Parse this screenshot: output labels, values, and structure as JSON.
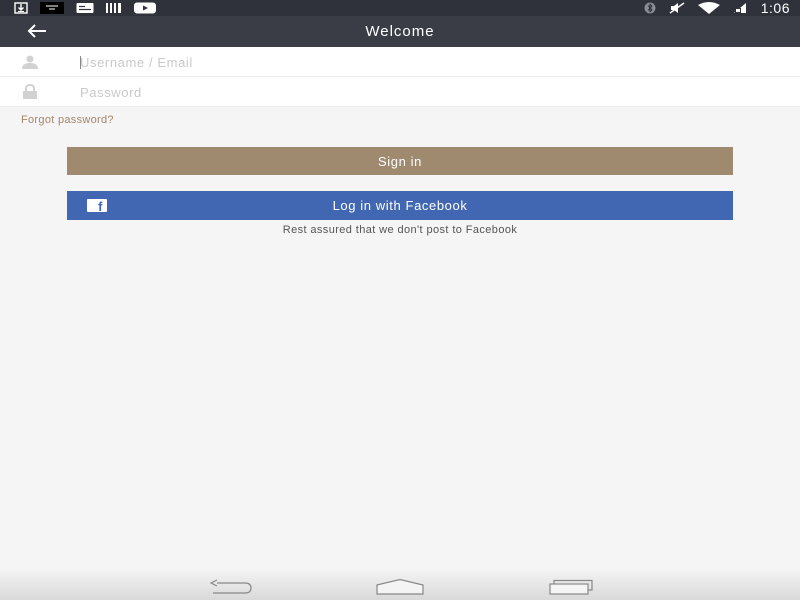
{
  "status_bar": {
    "time": "1:06",
    "left_icons": [
      "download-icon",
      "keyboard-icon",
      "message-icon",
      "barcode-icon",
      "youtube-icon"
    ],
    "right_icons": [
      "bluetooth-icon",
      "mute-icon",
      "wifi-icon",
      "signal-icon"
    ]
  },
  "app_bar": {
    "title": "Welcome"
  },
  "login": {
    "username_placeholder": "Username / Email",
    "password_placeholder": "Password",
    "forgot_password": "Forgot password?",
    "sign_in_label": "Sign in",
    "facebook_label": "Log in with Facebook",
    "facebook_note": "Rest assured that we don't post to Facebook"
  },
  "colors": {
    "status_bar": "#2f323a",
    "app_bar": "#3a3d46",
    "sign_in": "#a08a6f",
    "facebook": "#4267b2",
    "forgot_link": "#a5876a",
    "background": "#f5f5f5"
  },
  "nav_bar": {
    "buttons": [
      "back-icon",
      "home-icon",
      "recents-icon"
    ]
  }
}
